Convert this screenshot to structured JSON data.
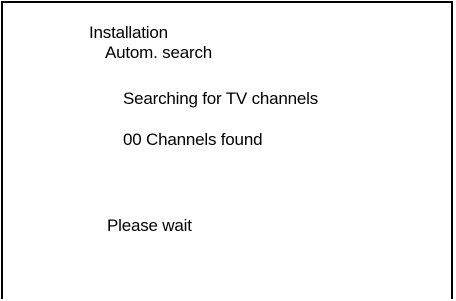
{
  "menu": {
    "title": "Installation",
    "subtitle": "Autom. search"
  },
  "search": {
    "status": "Searching for TV channels",
    "channels_found": "00 Channels found",
    "wait_message": "Please wait"
  },
  "colors": {
    "background": "#ffffff",
    "text": "#000000",
    "border": "#000000"
  }
}
